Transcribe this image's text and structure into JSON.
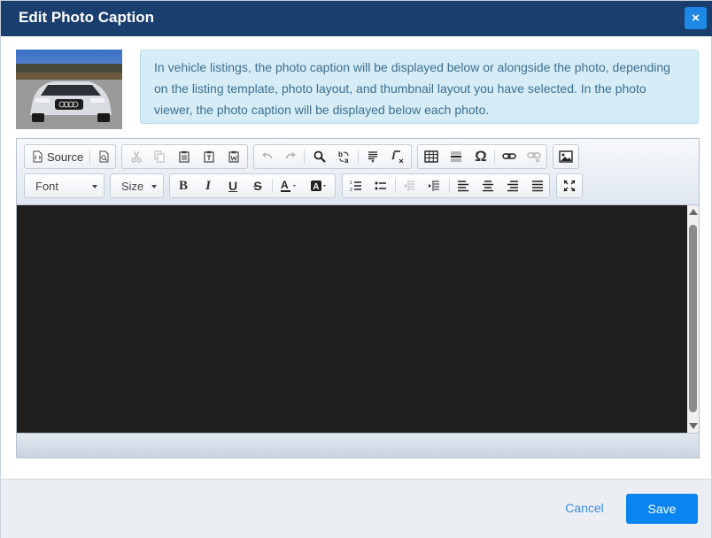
{
  "dialog": {
    "title": "Edit Photo Caption",
    "close_glyph": "×"
  },
  "photo": {
    "description_icon": "car-photo-thumbnail"
  },
  "info": {
    "text": "In vehicle listings, the photo caption will be displayed below or alongside the photo, depending on the listing template, photo layout, and thumbnail layout you have selected. In the photo viewer, the photo caption will be displayed below each photo."
  },
  "toolbar": {
    "source_label": "Source",
    "font_label": "Font",
    "size_label": "Size",
    "bold_glyph": "B",
    "italic_glyph": "I",
    "underline_glyph": "U",
    "strike_glyph": "S",
    "special_char_glyph": "Ω"
  },
  "footer": {
    "cancel_label": "Cancel",
    "save_label": "Save"
  },
  "colors": {
    "titlebar": "#1a3f6f",
    "accent": "#0a84f0",
    "info_bg": "#d6edf7",
    "editor_bg": "#1f1f1f"
  }
}
